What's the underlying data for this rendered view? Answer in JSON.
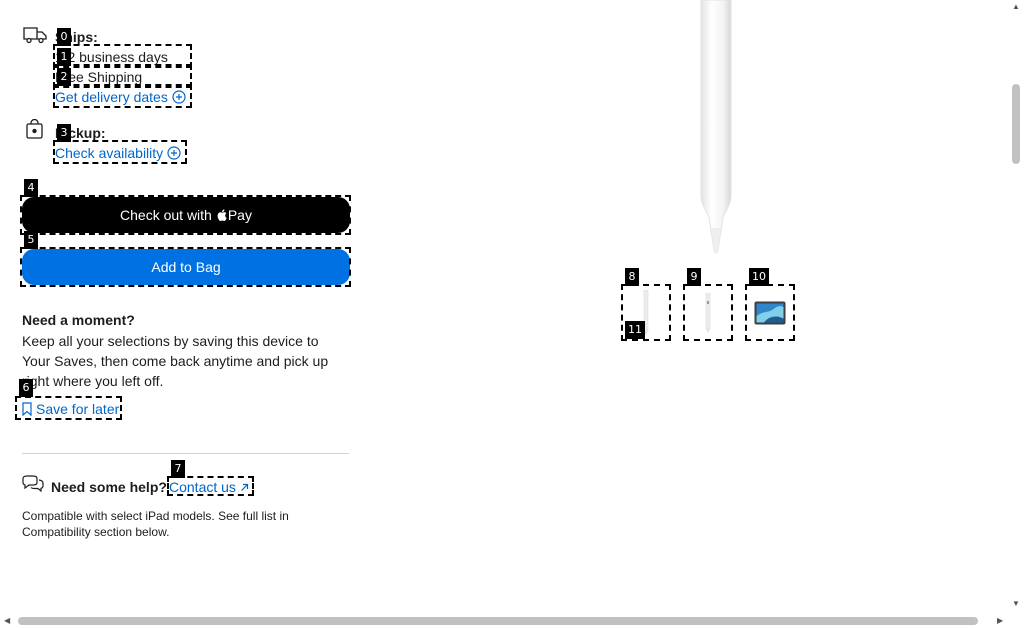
{
  "shipping": {
    "label": "Ships:",
    "timeframe": "1-2 business days",
    "cost": "Free Shipping",
    "delivery_link": "Get delivery dates"
  },
  "pickup": {
    "label": "Pickup:",
    "availability_link": "Check availability"
  },
  "buttons": {
    "apple_pay_prefix": "Check out with",
    "apple_pay_brand": "Pay",
    "add_to_bag": "Add to Bag"
  },
  "save": {
    "heading": "Need a moment?",
    "body": "Keep all your selections by saving this device to Your Saves, then come back anytime and pick up right where you left off.",
    "link": "Save for later"
  },
  "help": {
    "heading": "Need some help?",
    "link": "Contact us"
  },
  "compatibility_note": "Compatible with select iPad models. See full list in Compatibility section below.",
  "som_labels": [
    "0",
    "1",
    "2",
    "3",
    "4",
    "5",
    "6",
    "7",
    "8",
    "9",
    "10",
    "11"
  ],
  "colors": {
    "link": "#0066cc",
    "add_to_bag": "#0071e3",
    "apple_pay": "#000000"
  }
}
